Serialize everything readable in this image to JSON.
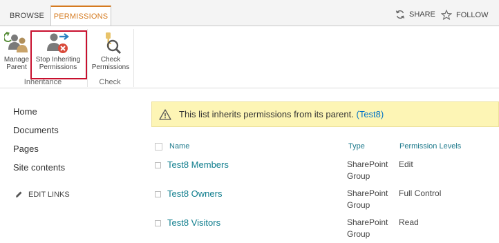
{
  "tabs": {
    "browse": "BROWSE",
    "permissions": "PERMISSIONS"
  },
  "top_links": {
    "share": "SHARE",
    "follow": "FOLLOW"
  },
  "ribbon": {
    "manage_parent_l1": "Manage",
    "manage_parent_l2": "Parent",
    "stop_inheriting_l1": "Stop Inheriting",
    "stop_inheriting_l2": "Permissions",
    "check_permissions_l1": "Check",
    "check_permissions_l2": "Permissions",
    "group_inheritance": "Inheritance",
    "group_check": "Check"
  },
  "nav": {
    "items": [
      "Home",
      "Documents",
      "Pages",
      "Site contents"
    ],
    "edit_links": "EDIT LINKS"
  },
  "notice": {
    "text": "This list inherits permissions from its parent.",
    "link": "(Test8)"
  },
  "table": {
    "headers": {
      "name": "Name",
      "type": "Type",
      "levels": "Permission Levels"
    },
    "rows": [
      {
        "name": "Test8 Members",
        "type_l1": "SharePoint",
        "type_l2": "Group",
        "level": "Edit"
      },
      {
        "name": "Test8 Owners",
        "type_l1": "SharePoint",
        "type_l2": "Group",
        "level": "Full Control"
      },
      {
        "name": "Test8 Visitors",
        "type_l1": "SharePoint",
        "type_l2": "Group",
        "level": "Read"
      }
    ]
  },
  "colors": {
    "accent": "#d57a1f",
    "link": "#0d7c8c",
    "highlight": "#c8102e",
    "notice_bg": "#fdf5b5"
  },
  "icons": [
    "sync-icon",
    "star-icon",
    "manage-parent-icon",
    "stop-inheriting-icon",
    "check-permissions-icon",
    "warning-icon",
    "pencil-icon"
  ]
}
